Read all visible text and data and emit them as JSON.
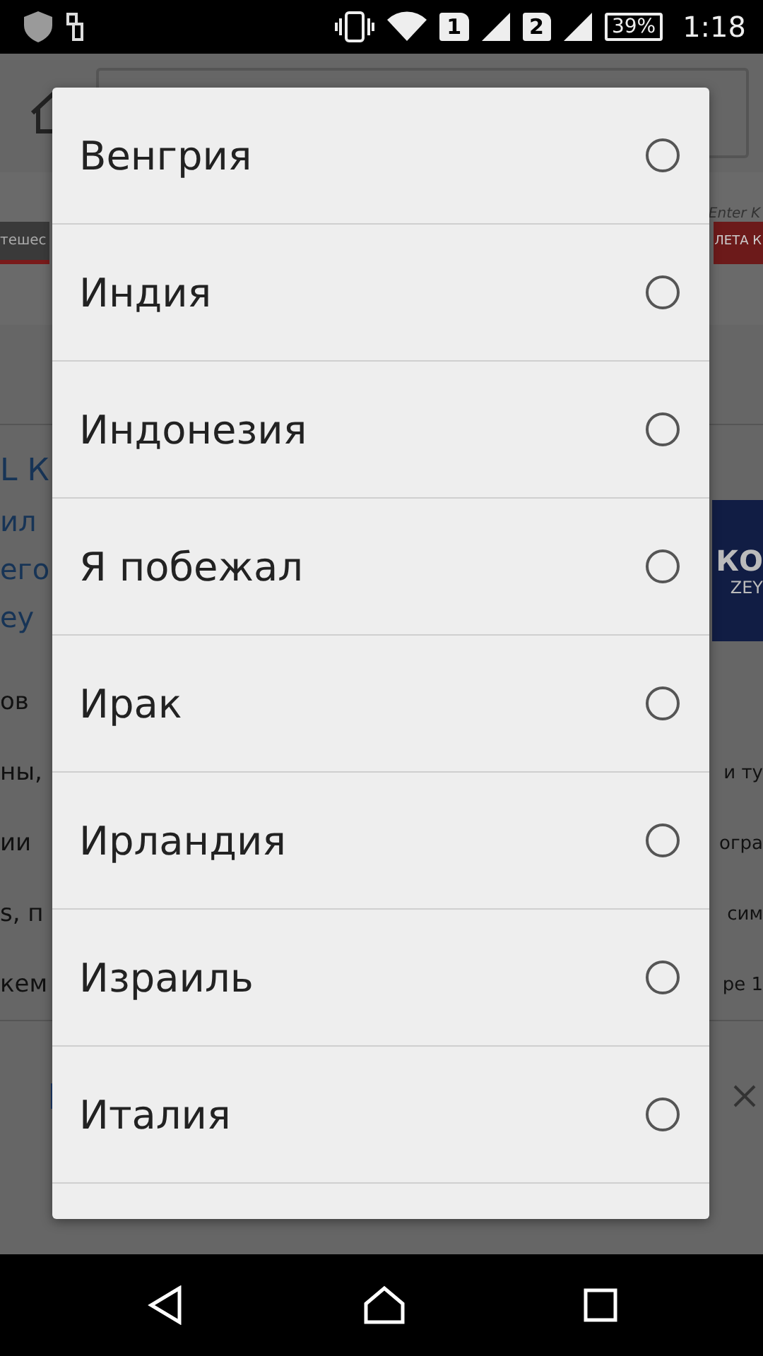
{
  "status_bar": {
    "sim_1": "1",
    "sim_2": "2",
    "battery": "39%",
    "time": "1:18"
  },
  "background_page": {
    "banner_left": "тешес",
    "banner_hint": "Enter K",
    "banner_right": "ЛЕТА К",
    "title": "L К",
    "subtitle_lines": [
      "ил",
      "его",
      "ey"
    ],
    "logo_lines": [
      "КО",
      "ZEY"
    ],
    "text_rows": [
      {
        "left": "ов"
      },
      {
        "left": "ны,",
        "right": "и ту"
      },
      {
        "left": "ии",
        "right": "огра"
      },
      {
        "left": "s, п",
        "right": "сим"
      },
      {
        "left": "кем",
        "right": "ре 1"
      }
    ]
  },
  "dialog": {
    "options": [
      {
        "label": "Венгрия",
        "selected": false
      },
      {
        "label": "Индия",
        "selected": false
      },
      {
        "label": "Индонезия",
        "selected": false
      },
      {
        "label": "Я побежал",
        "selected": false
      },
      {
        "label": "Ирак",
        "selected": false
      },
      {
        "label": "Ирландия",
        "selected": false
      },
      {
        "label": "Израиль",
        "selected": false
      },
      {
        "label": "Италия",
        "selected": false
      }
    ]
  }
}
